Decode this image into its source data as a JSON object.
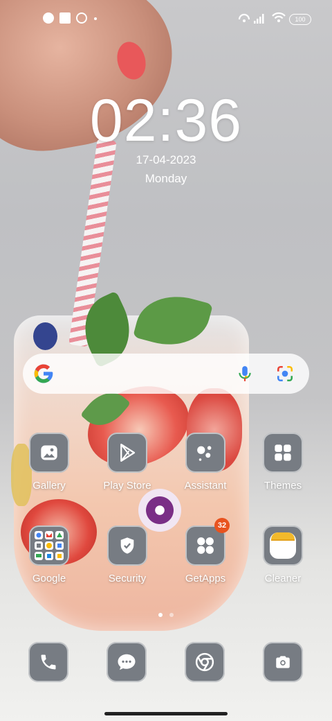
{
  "status_bar": {
    "battery": "100",
    "icons": [
      "notification-app-icon",
      "square-notification-icon",
      "location-icon",
      "dot-icon",
      "hotspot-icon",
      "signal-icon",
      "wifi-icon",
      "battery-icon"
    ]
  },
  "clock": {
    "time": "02:36",
    "date": "17-04-2023",
    "day": "Monday"
  },
  "search": {
    "icons": [
      "google-logo",
      "mic-icon",
      "google-lens-icon"
    ]
  },
  "apps": {
    "row1": [
      {
        "label": "Gallery",
        "icon": "gallery-icon"
      },
      {
        "label": "Play Store",
        "icon": "play-store-icon"
      },
      {
        "label": "Assistant",
        "icon": "assistant-icon"
      },
      {
        "label": "Themes",
        "icon": "themes-icon"
      }
    ],
    "row2": [
      {
        "label": "Google",
        "icon": "google-folder-icon"
      },
      {
        "label": "Security",
        "icon": "security-shield-icon"
      },
      {
        "label": "GetApps",
        "icon": "getapps-icon",
        "badge": "32"
      },
      {
        "label": "Cleaner",
        "icon": "cleaner-icon"
      }
    ]
  },
  "pager": {
    "pages": 2,
    "active": 1
  },
  "dock": [
    "phone-icon",
    "messages-icon",
    "chrome-icon",
    "camera-icon"
  ],
  "colors": {
    "icon_bg": "#777c83",
    "badge": "#e8531f",
    "google_blue": "#4285F4",
    "google_red": "#EA4335",
    "google_yellow": "#FBBC05",
    "google_green": "#34A853"
  }
}
